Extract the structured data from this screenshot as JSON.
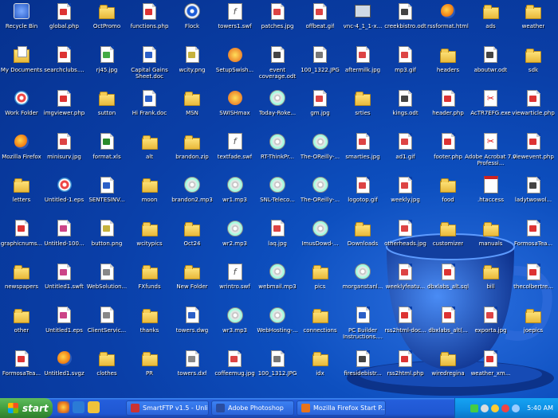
{
  "desktop": {
    "icons": [
      {
        "label": "Recycle Bin",
        "type": "rec"
      },
      {
        "label": "global.php",
        "type": "doc",
        "mark": "#d33"
      },
      {
        "label": "OctPromo",
        "type": "folder"
      },
      {
        "label": "functions.php",
        "type": "doc",
        "mark": "#d33"
      },
      {
        "label": "Flock",
        "type": "disc"
      },
      {
        "label": "towers1.swf",
        "type": "swf"
      },
      {
        "label": "patches.jpg",
        "type": "doc",
        "mark": "#d44"
      },
      {
        "label": "offbeat.gif",
        "type": "doc",
        "mark": "#d44"
      },
      {
        "label": "vnc-4_1_1-x...",
        "type": "pc"
      },
      {
        "label": "creekbistro.odt",
        "type": "doc",
        "mark": "#444"
      },
      {
        "label": "rssformat.html",
        "type": "fire"
      },
      {
        "label": "ads",
        "type": "folder"
      },
      {
        "label": "weather",
        "type": "folder"
      },
      {
        "label": "My Documents",
        "type": "mydocs"
      },
      {
        "label": "searchclubs....",
        "type": "doc",
        "mark": "#d33"
      },
      {
        "label": "rj45.jpg",
        "type": "doc",
        "mark": "#4a4"
      },
      {
        "label": "Capital Gains Sheet.doc",
        "type": "doc",
        "mark": "#2b5fc7",
        "two": true
      },
      {
        "label": "wcity.png",
        "type": "doc",
        "mark": "#c6b23c"
      },
      {
        "label": "SetupSwish...",
        "type": "swish"
      },
      {
        "label": "event coverage.odt",
        "type": "doc",
        "mark": "#444",
        "two": true
      },
      {
        "label": "100_1322.JPG",
        "type": "doc",
        "mark": "#777"
      },
      {
        "label": "aftermilk.jpg",
        "type": "doc",
        "mark": "#d44"
      },
      {
        "label": "mp3.gif",
        "type": "doc",
        "mark": "#d44"
      },
      {
        "label": "headers",
        "type": "folder"
      },
      {
        "label": "aboutwr.odt",
        "type": "doc",
        "mark": "#444"
      },
      {
        "label": "sdk",
        "type": "folder"
      },
      {
        "label": "Work Folder",
        "type": "target"
      },
      {
        "label": "imgviewer.php",
        "type": "doc",
        "mark": "#d33"
      },
      {
        "label": "sutton",
        "type": "folder"
      },
      {
        "label": "Hi Frank.doc",
        "type": "doc",
        "mark": "#2b5fc7"
      },
      {
        "label": "MSN",
        "type": "folder"
      },
      {
        "label": "SWISHmax",
        "type": "swish"
      },
      {
        "label": "Today-Roke...",
        "type": "cd"
      },
      {
        "label": "gm.jpg",
        "type": "doc",
        "mark": "#d44"
      },
      {
        "label": "srties",
        "type": "folder"
      },
      {
        "label": "kings.odt",
        "type": "doc",
        "mark": "#444"
      },
      {
        "label": "header.php",
        "type": "doc",
        "mark": "#d33"
      },
      {
        "label": "AcTR7EFG.exe",
        "type": "pdf"
      },
      {
        "label": "viewarticle.php",
        "type": "doc",
        "mark": "#d33"
      },
      {
        "label": "Mozilla Firefox",
        "type": "fire"
      },
      {
        "label": "minisurv.jpg",
        "type": "doc",
        "mark": "#d44"
      },
      {
        "label": "format.xls",
        "type": "doc",
        "mark": "#2a8a2a"
      },
      {
        "label": "alt",
        "type": "folder"
      },
      {
        "label": "brandon.zip",
        "type": "folder"
      },
      {
        "label": "textfade.swf",
        "type": "swf"
      },
      {
        "label": "RT-ThinkPr...",
        "type": "cd"
      },
      {
        "label": "The-OReilly-...",
        "type": "cd"
      },
      {
        "label": "smarties.jpg",
        "type": "doc",
        "mark": "#d44"
      },
      {
        "label": "ad1.gif",
        "type": "doc",
        "mark": "#d44"
      },
      {
        "label": "footer.php",
        "type": "doc",
        "mark": "#d33"
      },
      {
        "label": "Adobe Acrobat 7.0 Professi...",
        "type": "pdf",
        "two": true
      },
      {
        "label": "viewevent.php",
        "type": "doc",
        "mark": "#d33"
      },
      {
        "label": "letters",
        "type": "folder"
      },
      {
        "label": "Untitled-1.eps",
        "type": "target"
      },
      {
        "label": "SENTESINV...",
        "type": "doc",
        "mark": "#2b5fc7"
      },
      {
        "label": "moon",
        "type": "folder"
      },
      {
        "label": "brandon2.mp3",
        "type": "cd"
      },
      {
        "label": "wr1.mp3",
        "type": "cd"
      },
      {
        "label": "SNL-Teleco...",
        "type": "cd"
      },
      {
        "label": "The-OReilly-...",
        "type": "cd"
      },
      {
        "label": "logotop.gif",
        "type": "doc",
        "mark": "#d44"
      },
      {
        "label": "weekly.jpg",
        "type": "doc",
        "mark": "#d44"
      },
      {
        "label": "food",
        "type": "folder"
      },
      {
        "label": ".htaccess",
        "type": "cal"
      },
      {
        "label": "ladytwowol...",
        "type": "doc",
        "mark": "#444"
      },
      {
        "label": "graphicnums...",
        "type": "doc",
        "mark": "#d33"
      },
      {
        "label": "Untitled-100...",
        "type": "doc",
        "mark": "#c48"
      },
      {
        "label": "button.png",
        "type": "doc",
        "mark": "#c6b23c"
      },
      {
        "label": "wcitypics",
        "type": "folder"
      },
      {
        "label": "Oct24",
        "type": "folder"
      },
      {
        "label": "wr2.mp3",
        "type": "cd"
      },
      {
        "label": "laq.jpg",
        "type": "doc",
        "mark": "#d44"
      },
      {
        "label": "ImusDowd-...",
        "type": "cd"
      },
      {
        "label": "Downloads",
        "type": "folder"
      },
      {
        "label": "otherheads.jpg",
        "type": "doc",
        "mark": "#d44"
      },
      {
        "label": "customizer",
        "type": "folder"
      },
      {
        "label": "manuals",
        "type": "folder"
      },
      {
        "label": "FormosaTea...",
        "type": "doc",
        "mark": "#d33"
      },
      {
        "label": "newspapers",
        "type": "folder"
      },
      {
        "label": "Untitled1.swft",
        "type": "doc",
        "mark": "#c48"
      },
      {
        "label": "WebSolution...",
        "type": "doc",
        "mark": "#888"
      },
      {
        "label": "FXfunds",
        "type": "folder"
      },
      {
        "label": "New Folder",
        "type": "folder"
      },
      {
        "label": "wrintro.swf",
        "type": "swf"
      },
      {
        "label": "webmail.mp3",
        "type": "cd"
      },
      {
        "label": "pics",
        "type": "folder"
      },
      {
        "label": "morganstanl...",
        "type": "cd"
      },
      {
        "label": "weeklyfeatu...",
        "type": "doc",
        "mark": "#d44"
      },
      {
        "label": "dbxlabs_alt.sql",
        "type": "doc",
        "mark": "#d33"
      },
      {
        "label": "bill",
        "type": "folder"
      },
      {
        "label": "thecolbertre...",
        "type": "doc",
        "mark": "#d33"
      },
      {
        "label": "other",
        "type": "folder"
      },
      {
        "label": "Untitled1.eps",
        "type": "doc",
        "mark": "#c48"
      },
      {
        "label": "ClientServic...",
        "type": "doc",
        "mark": "#888"
      },
      {
        "label": "thanks",
        "type": "folder"
      },
      {
        "label": "towers.dwg",
        "type": "doc",
        "mark": "#2b5fc7"
      },
      {
        "label": "wr3.mp3",
        "type": "cd"
      },
      {
        "label": "WebHosting-...",
        "type": "cd"
      },
      {
        "label": "connections",
        "type": "folder"
      },
      {
        "label": "PC Builder Instructions....",
        "type": "doc",
        "mark": "#2b5fc7",
        "two": true
      },
      {
        "label": "rss2html-doc...",
        "type": "doc",
        "mark": "#d33"
      },
      {
        "label": "dbxlabs_alt(...",
        "type": "doc",
        "mark": "#d33"
      },
      {
        "label": "exporta.jpg",
        "type": "doc",
        "mark": "#d44"
      },
      {
        "label": "joepics",
        "type": "folder"
      },
      {
        "label": "FormosaTea...",
        "type": "doc",
        "mark": "#d33"
      },
      {
        "label": "Untitled1.svgz",
        "type": "fire"
      },
      {
        "label": "clothes",
        "type": "folder"
      },
      {
        "label": "PR",
        "type": "folder"
      },
      {
        "label": "towers.dxf",
        "type": "doc",
        "mark": "#888"
      },
      {
        "label": "coffeemug.jpg",
        "type": "doc",
        "mark": "#d44"
      },
      {
        "label": "100_1312.JPG",
        "type": "doc",
        "mark": "#777"
      },
      {
        "label": "idx",
        "type": "folder"
      },
      {
        "label": "firesidebistr...",
        "type": "doc",
        "mark": "#444"
      },
      {
        "label": "rss2html.php",
        "type": "doc",
        "mark": "#d33"
      },
      {
        "label": "wiredregina",
        "type": "folder"
      },
      {
        "label": "weather_xm...",
        "type": "doc",
        "mark": "#d33"
      },
      {
        "label": "",
        "type": "none"
      }
    ]
  },
  "taskbar": {
    "start_label": "start",
    "tasks": [
      {
        "label": "SmartFTP v1.5 - Unlic...",
        "color": "#c33"
      },
      {
        "label": "Adobe Photoshop",
        "color": "#2a4da0"
      },
      {
        "label": "Mozilla Firefox Start P...",
        "color": "#e8731b"
      }
    ],
    "clock": "5:40 AM"
  }
}
